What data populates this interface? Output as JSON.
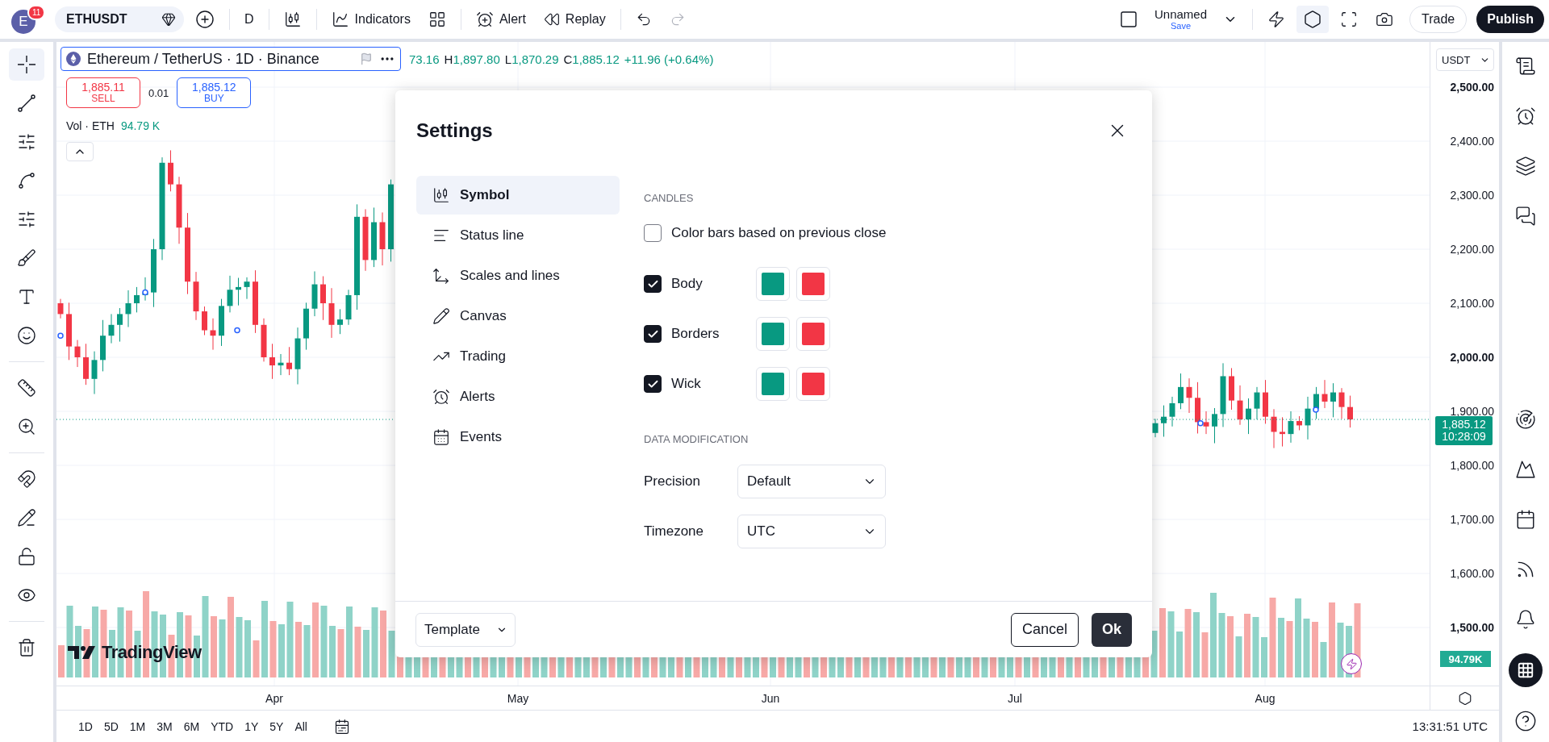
{
  "top_bar": {
    "avatar": {
      "letter": "E",
      "badge": "11"
    },
    "symbol": "ETHUSDT",
    "interval": "D",
    "indicators": "Indicators",
    "alert": "Alert",
    "replay": "Replay",
    "layout": {
      "name": "Unnamed",
      "save": "Save"
    },
    "trade": "Trade",
    "publish": "Publish"
  },
  "chart": {
    "legend": {
      "title": "Ethereum / TetherUS · 1D · Binance"
    },
    "ohlc": [
      {
        "value": "73.16"
      },
      {
        "label": "H",
        "value": "1,897.80"
      },
      {
        "label": "L",
        "value": "1,870.29"
      },
      {
        "label": "C",
        "value": "1,885.12"
      },
      {
        "value": "+11.96 (+0.64%)"
      }
    ],
    "sell": {
      "price": "1,885.11",
      "label": "SELL"
    },
    "spread": "0.01",
    "buy": {
      "price": "1,885.12",
      "label": "BUY"
    },
    "volume": {
      "label": "Vol · ETH",
      "value": "94.79 K"
    },
    "brand": "TradingView",
    "currency": "USDT",
    "price_ticks": [
      {
        "label": "2,500.00",
        "bold": true
      },
      {
        "label": "2,400.00",
        "bold": false
      },
      {
        "label": "2,300.00",
        "bold": false
      },
      {
        "label": "2,200.00",
        "bold": false
      },
      {
        "label": "2,100.00",
        "bold": false
      },
      {
        "label": "2,000.00",
        "bold": true
      },
      {
        "label": "1,900.00",
        "bold": false
      },
      {
        "label": "1,800.00",
        "bold": false
      },
      {
        "label": "1,700.00",
        "bold": false
      },
      {
        "label": "1,600.00",
        "bold": false
      },
      {
        "label": "1,500.00",
        "bold": true
      }
    ],
    "last_price": {
      "price": "1,885.12",
      "countdown": "10:28:09"
    },
    "volume_tag": "94.79K",
    "time_labels": [
      "Apr",
      "May",
      "Jun",
      "Jul",
      "Aug"
    ]
  },
  "bottom_bar": {
    "ranges": [
      "1D",
      "5D",
      "1M",
      "3M",
      "6M",
      "YTD",
      "1Y",
      "5Y",
      "All"
    ],
    "clock": "13:31:51 UTC"
  },
  "dialog": {
    "title": "Settings",
    "nav": [
      {
        "label": "Symbol",
        "selected": true
      },
      {
        "label": "Status line",
        "selected": false
      },
      {
        "label": "Scales and lines",
        "selected": false
      },
      {
        "label": "Canvas",
        "selected": false
      },
      {
        "label": "Trading",
        "selected": false
      },
      {
        "label": "Alerts",
        "selected": false
      },
      {
        "label": "Events",
        "selected": false
      }
    ],
    "candles_heading": "CANDLES",
    "color_bars": {
      "label": "Color bars based on previous close",
      "checked": false
    },
    "candle_rows": [
      {
        "label": "Body",
        "checked": true,
        "swatches": [
          {
            "color": "#089981"
          },
          {
            "color": "#f23645"
          }
        ]
      },
      {
        "label": "Borders",
        "checked": true,
        "swatches": [
          {
            "color": "#089981"
          },
          {
            "color": "#f23645"
          }
        ]
      },
      {
        "label": "Wick",
        "checked": true,
        "swatches": [
          {
            "color": "#089981"
          },
          {
            "color": "#f23645"
          }
        ]
      }
    ],
    "data_heading": "DATA MODIFICATION",
    "selects": [
      {
        "label": "Precision",
        "value": "Default"
      },
      {
        "label": "Timezone",
        "value": "UTC"
      }
    ],
    "template": "Template",
    "cancel": "Cancel",
    "ok": "Ok"
  }
}
